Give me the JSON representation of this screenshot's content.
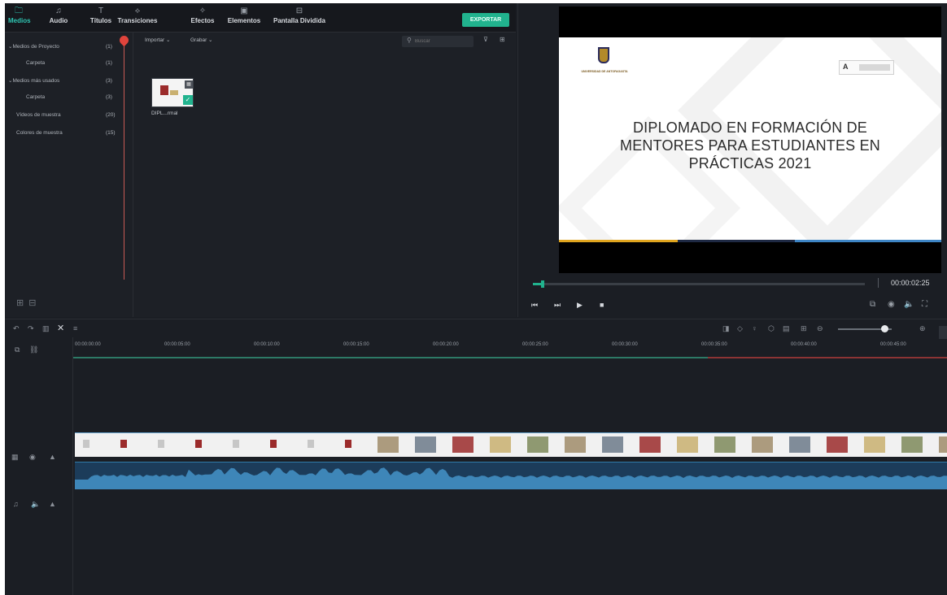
{
  "toolbar": {
    "tabs": [
      {
        "label": "Medios",
        "icon": "folder-icon",
        "glyph": "🗀",
        "active": true
      },
      {
        "label": "Audio",
        "icon": "music-note-icon",
        "glyph": "♫",
        "active": false
      },
      {
        "label": "Títulos",
        "icon": "title-icon",
        "glyph": "T",
        "active": false
      },
      {
        "label": "Transiciones",
        "icon": "transition-icon",
        "glyph": "⟡",
        "active": false
      },
      {
        "label": "Efectos",
        "icon": "effects-icon",
        "glyph": "✧",
        "active": false
      },
      {
        "label": "Elementos",
        "icon": "elements-icon",
        "glyph": "▣",
        "active": false
      },
      {
        "label": "Pantalla Dividida",
        "icon": "split-screen-icon",
        "glyph": "⊟",
        "active": false
      }
    ],
    "export_label": "EXPORTAR"
  },
  "folders": [
    {
      "name": "Medios de Proyecto",
      "count": "(1)",
      "indent": false,
      "expanded": true
    },
    {
      "name": "Carpeta",
      "count": "(1)",
      "indent": true
    },
    {
      "name": "Medios más usados",
      "count": "(3)",
      "indent": false,
      "expanded": true
    },
    {
      "name": "Carpeta",
      "count": "(3)",
      "indent": true
    },
    {
      "name": "Vídeos de muestra",
      "count": "(20)",
      "indent": false
    },
    {
      "name": "Colores de muestra",
      "count": "(15)",
      "indent": false
    }
  ],
  "media": {
    "import_label": "Importar",
    "record_label": "Grabar",
    "search_placeholder": "Buscar",
    "items": [
      {
        "name": "DIPL...rmal"
      }
    ]
  },
  "preview": {
    "slide_title_lines": [
      "DIPLOMADO EN FORMACIÓN DE",
      "MENTORES PARA ESTUDIANTES EN",
      "PRÁCTICAS 2021"
    ],
    "university_name": "UNIVERSIDAD DE ANTOFAGASTA",
    "acred_logo_text": "A",
    "timecode": "00:00:02:25",
    "progress_fraction": 0.03
  },
  "timeline": {
    "ruler_labels": [
      "00:00:00:00",
      "00:00:05:00",
      "00:00:10:00",
      "00:00:15:00",
      "00:00:20:00",
      "00:00:25:00",
      "00:00:30:00",
      "00:00:35:00",
      "00:00:40:00",
      "00:00:45:00"
    ],
    "colors": {
      "accent": "#21b38e",
      "playhead": "#e0443c",
      "audio": "#2f79a8"
    }
  }
}
